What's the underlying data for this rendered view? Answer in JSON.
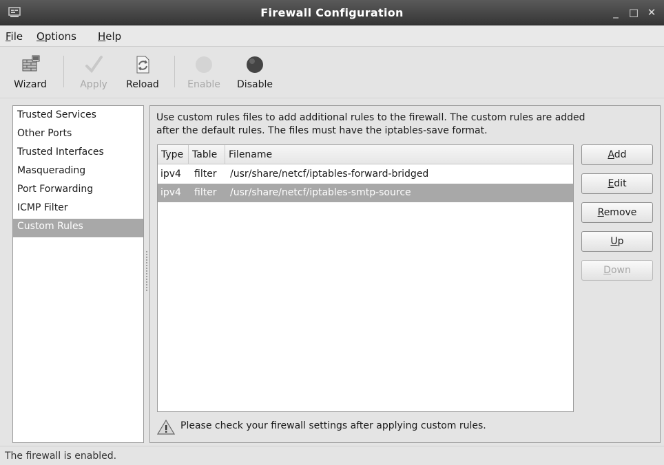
{
  "window": {
    "title": "Firewall Configuration",
    "controls": [
      "minimize-icon",
      "maximize-icon",
      "close-icon"
    ]
  },
  "menubar": {
    "items": [
      {
        "label": "File",
        "mnemonic": "F"
      },
      {
        "label": "Options",
        "mnemonic": "O"
      },
      {
        "label": "Help",
        "mnemonic": "H"
      }
    ]
  },
  "toolbar": {
    "wizard": {
      "label": "Wizard",
      "icon": "wizard-icon",
      "enabled": true
    },
    "apply": {
      "label": "Apply",
      "icon": "checkmark-icon",
      "enabled": false
    },
    "reload": {
      "label": "Reload",
      "icon": "reload-icon",
      "enabled": true
    },
    "enable": {
      "label": "Enable",
      "icon": "enable-icon",
      "enabled": false
    },
    "disable": {
      "label": "Disable",
      "icon": "disable-icon",
      "enabled": true
    }
  },
  "sidebar": {
    "items": [
      {
        "label": "Trusted Services"
      },
      {
        "label": "Other Ports"
      },
      {
        "label": "Trusted Interfaces"
      },
      {
        "label": "Masquerading"
      },
      {
        "label": "Port Forwarding"
      },
      {
        "label": "ICMP Filter"
      },
      {
        "label": "Custom Rules",
        "selected": true
      }
    ]
  },
  "content": {
    "description_line1": "Use custom rules files to add additional rules to the firewall. The custom rules are added",
    "description_line2": "after the default rules. The files must have the iptables-save format.",
    "table": {
      "columns": [
        "Type",
        "Table",
        "Filename"
      ],
      "rows": [
        {
          "type": "ipv4",
          "table": "filter",
          "filename": "/usr/share/netcf/iptables-forward-bridged",
          "selected": false
        },
        {
          "type": "ipv4",
          "table": "filter",
          "filename": "/usr/share/netcf/iptables-smtp-source",
          "selected": true
        }
      ]
    },
    "buttons": {
      "add": {
        "pre": "",
        "mnemonic": "A",
        "post": "dd",
        "enabled": true
      },
      "edit": {
        "pre": "",
        "mnemonic": "E",
        "post": "dit",
        "enabled": true
      },
      "remove": {
        "pre": "",
        "mnemonic": "R",
        "post": "emove",
        "enabled": true
      },
      "up": {
        "pre": "",
        "mnemonic": "U",
        "post": "p",
        "enabled": true
      },
      "down": {
        "pre": "",
        "mnemonic": "D",
        "post": "own",
        "enabled": false
      }
    },
    "warning": {
      "icon": "warning-icon",
      "text": "Please check your firewall settings after applying custom rules."
    }
  },
  "statusbar": {
    "text": "The firewall is enabled."
  },
  "colors": {
    "titlebar": "#3f3f3f",
    "selection": "#a8a8a8",
    "window_bg": "#e4e4e4"
  }
}
